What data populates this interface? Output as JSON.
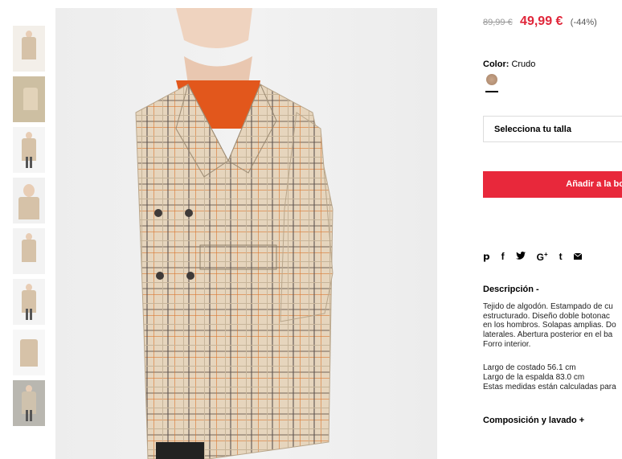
{
  "thumbnails": [
    {
      "name": "thumb-1"
    },
    {
      "name": "thumb-2"
    },
    {
      "name": "thumb-3"
    },
    {
      "name": "thumb-4"
    },
    {
      "name": "thumb-5"
    },
    {
      "name": "thumb-6"
    },
    {
      "name": "thumb-7"
    },
    {
      "name": "thumb-8"
    }
  ],
  "product": {
    "old_price": "89,99 €",
    "new_price": "49,99 €",
    "discount": "(-44%)",
    "color_label": "Color:",
    "color_value": "Crudo",
    "size_placeholder": "Selecciona tu talla",
    "add_button": "Añadir a la bo"
  },
  "share_icons": [
    "pinterest-icon",
    "facebook-icon",
    "twitter-icon",
    "google-plus-icon",
    "tumblr-icon",
    "email-icon"
  ],
  "description": {
    "title": "Descripción -",
    "lines": [
      "Tejido de algodón. Estampado de cu",
      "estructurado. Diseño doble botonac",
      "en los hombros. Solapas amplias. Do",
      "laterales. Abertura posterior en el ba",
      "Forro interior."
    ],
    "measures": [
      "Largo de costado 56.1 cm",
      "Largo de la espalda 83.0 cm",
      "Estas medidas están calculadas para"
    ]
  },
  "composition_label": "Composición y lavado +",
  "colors": {
    "accent": "#e8283b",
    "price": "#e0263a"
  }
}
